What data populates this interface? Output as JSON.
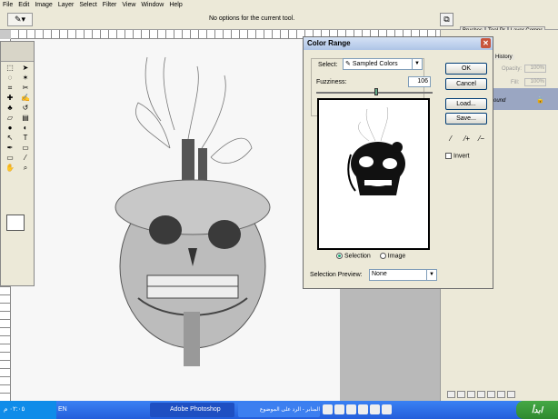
{
  "menu": [
    "File",
    "Edit",
    "Image",
    "Layer",
    "Select",
    "Filter",
    "View",
    "Window",
    "Help"
  ],
  "options_bar": {
    "message": "No options for the current tool."
  },
  "palette_tabs": [
    "Brushes",
    "Tool Pr",
    "Layer Comps"
  ],
  "dialog": {
    "title": "Color Range",
    "select_label": "Select:",
    "select_value": "Sampled Colors",
    "fuzziness_label": "Fuzziness:",
    "fuzziness_value": "106",
    "fuzziness_fraction": 0.53,
    "radio_selection": "Selection",
    "radio_image": "Image",
    "selection_mode": "Selection",
    "preview_label": "Selection Preview:",
    "preview_value": "None",
    "buttons": {
      "ok": "OK",
      "cancel": "Cancel",
      "load": "Load...",
      "save": "Save..."
    },
    "invert": "Invert",
    "invert_checked": false
  },
  "right_panel": {
    "history_tab": "History",
    "opacity_label": "Opacity:",
    "opacity_value": "100%",
    "fill_label": "Fill:",
    "fill_value": "100%",
    "layer_name": "ound"
  },
  "taskbar": {
    "start": "ابدأ",
    "tray_time": "٠٢:٠٥ م",
    "lang": "EN",
    "photoshop": "Adobe Photoshop",
    "forum": "المنابر - الرد على الموضوع"
  }
}
